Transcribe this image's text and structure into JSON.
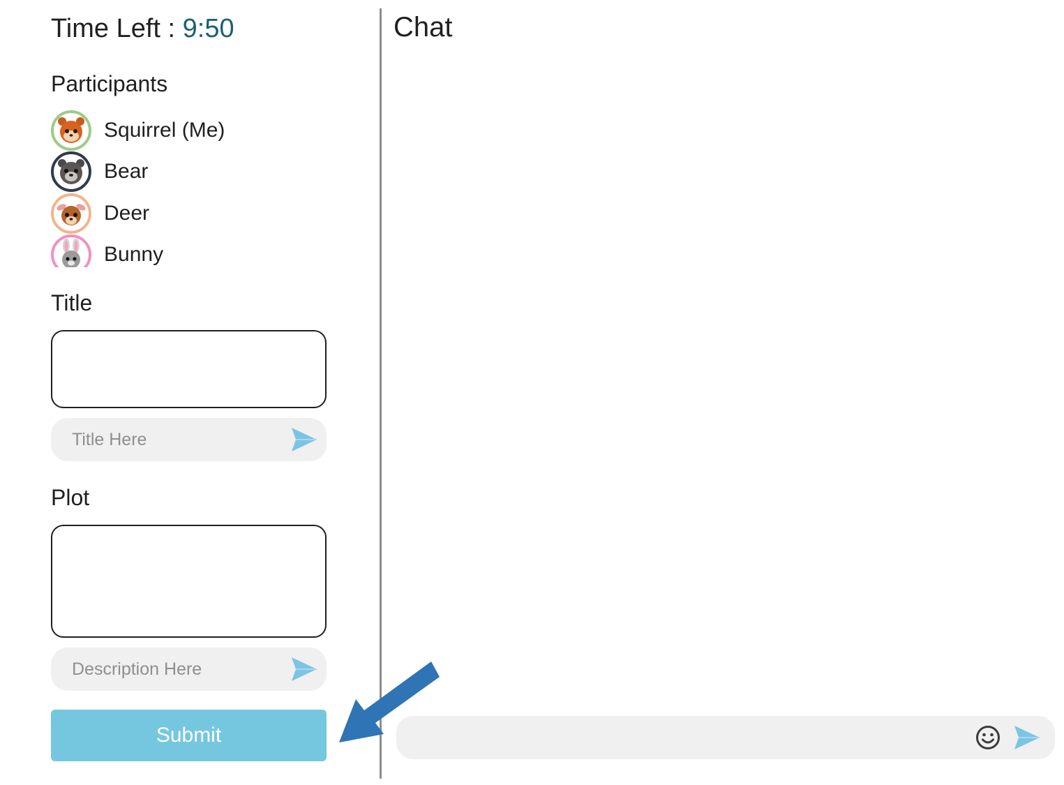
{
  "timer": {
    "label": "Time Left : ",
    "value": "9:50"
  },
  "participants": {
    "heading": "Participants",
    "items": [
      {
        "name": "Squirrel (Me)",
        "icon": "squirrel-icon",
        "ring_color": "#9ccc85"
      },
      {
        "name": "Bear",
        "icon": "bear-icon",
        "ring_color": "#2f3b4c"
      },
      {
        "name": "Deer",
        "icon": "deer-icon",
        "ring_color": "#f2b58a"
      },
      {
        "name": "Bunny",
        "icon": "bunny-icon",
        "ring_color": "#f28fc2"
      }
    ]
  },
  "title_section": {
    "heading": "Title",
    "input_placeholder": "Title Here",
    "send_icon": "send-icon"
  },
  "plot_section": {
    "heading": "Plot",
    "input_placeholder": "Description Here",
    "send_icon": "send-icon"
  },
  "submit": {
    "label": "Submit"
  },
  "chat": {
    "title": "Chat",
    "input_value": "",
    "emoji_icon": "smiley-icon",
    "send_icon": "send-icon"
  },
  "annotation": {
    "icon": "pointer-arrow-icon",
    "color": "#2f74b5"
  },
  "colors": {
    "accent": "#75c7e0",
    "timer_value": "#1d5f74",
    "send": "#7cc4e4"
  }
}
